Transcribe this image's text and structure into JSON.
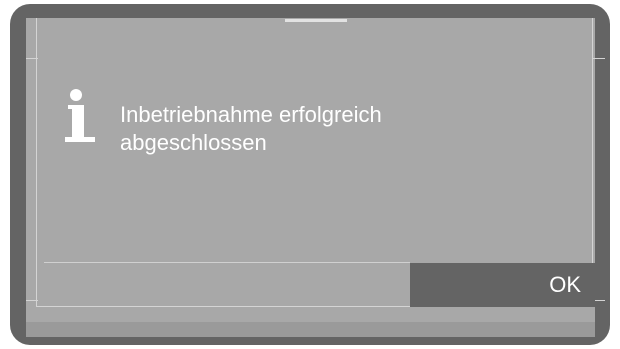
{
  "dialog": {
    "icon": "info-icon",
    "message_line1": "Inbetriebnahme erfolgreich",
    "message_line2": "abgeschlossen",
    "ok_label": "OK"
  },
  "colors": {
    "frame": "#646464",
    "screen": "#a8a8a8",
    "button": "#646464",
    "text": "#ffffff"
  }
}
